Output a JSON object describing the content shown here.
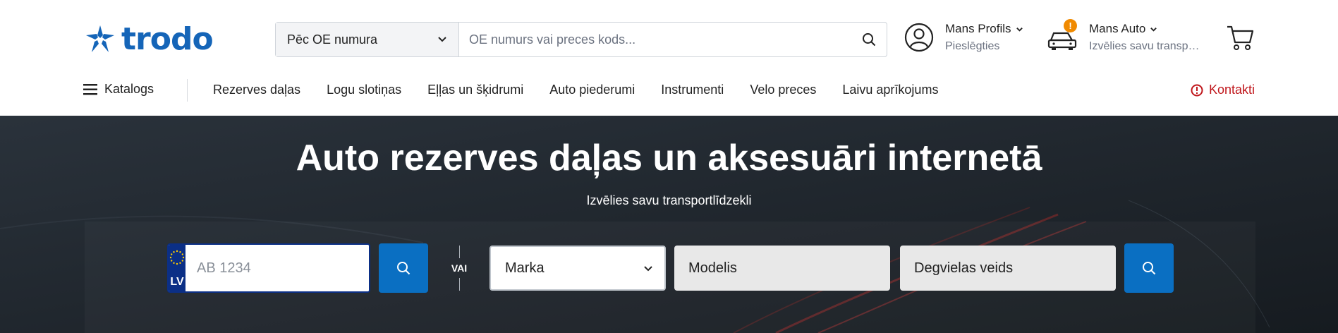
{
  "brand": {
    "name": "trodo"
  },
  "search": {
    "selector_value": "Pēc OE numura",
    "placeholder": "OE numurs vai preces kods..."
  },
  "profile": {
    "title": "Mans Profils",
    "subtitle": "Pieslēgties"
  },
  "my_auto": {
    "title": "Mans Auto",
    "subtitle": "Izvēlies savu transportlīdzekli",
    "badge": "!"
  },
  "nav": {
    "catalog_label": "Katalogs",
    "items": [
      "Rezerves daļas",
      "Logu slotiņas",
      "Eļļas un šķidrumi",
      "Auto piederumi",
      "Instrumenti",
      "Velo preces",
      "Laivu aprīkojums"
    ],
    "contact_label": "Kontakti"
  },
  "hero": {
    "title": "Auto rezerves daļas un aksesuāri internetā",
    "subtitle": "Izvēlies savu transportlīdzekli",
    "plate_country": "LV",
    "plate_placeholder": "AB 1234",
    "or_label": "VAI",
    "make_label": "Marka",
    "model_label": "Modelis",
    "fuel_label": "Degvielas veids"
  },
  "colors": {
    "brand_blue": "#1565b8",
    "button_blue": "#0a6fc2",
    "contact_red": "#c0171c",
    "badge_orange": "#f08a00",
    "hero_bg": "#1f262d"
  },
  "icons": [
    "logo-star-icon",
    "chevron-down-icon",
    "search-icon",
    "user-icon",
    "car-icon",
    "cart-icon",
    "menu-icon",
    "info-icon",
    "eu-stars-icon"
  ]
}
